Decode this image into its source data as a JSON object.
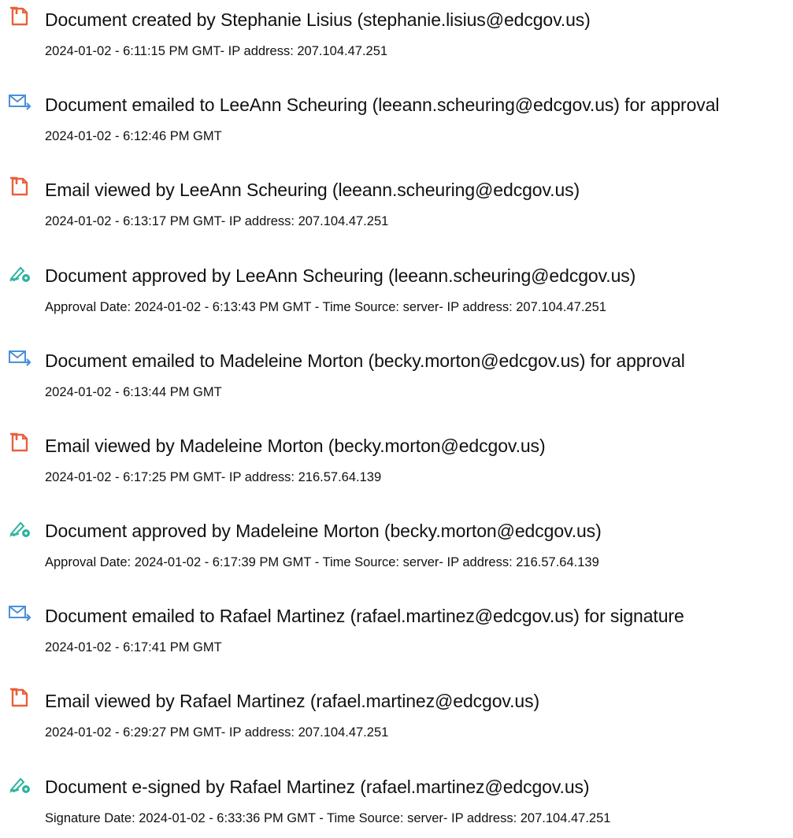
{
  "audit_events": [
    {
      "icon": "document-created-icon",
      "title": "Document created by Stephanie Lisius (stephanie.lisius@edcgov.us)",
      "detail": "2024-01-02 - 6:11:15 PM GMT- IP address: 207.104.47.251"
    },
    {
      "icon": "email-sent-icon",
      "title": "Document emailed to LeeAnn Scheuring (leeann.scheuring@edcgov.us) for approval",
      "detail": "2024-01-02 - 6:12:46 PM GMT"
    },
    {
      "icon": "document-created-icon",
      "title": "Email viewed by LeeAnn Scheuring (leeann.scheuring@edcgov.us)",
      "detail": "2024-01-02 - 6:13:17 PM GMT- IP address: 207.104.47.251"
    },
    {
      "icon": "signature-pen-icon",
      "title": "Document approved by LeeAnn Scheuring (leeann.scheuring@edcgov.us)",
      "detail": "Approval Date: 2024-01-02 - 6:13:43 PM GMT - Time Source: server- IP address: 207.104.47.251"
    },
    {
      "icon": "email-sent-icon",
      "title": "Document emailed to Madeleine Morton (becky.morton@edcgov.us) for approval",
      "detail": "2024-01-02 - 6:13:44 PM GMT"
    },
    {
      "icon": "document-created-icon",
      "title": "Email viewed by Madeleine Morton (becky.morton@edcgov.us)",
      "detail": "2024-01-02 - 6:17:25 PM GMT- IP address: 216.57.64.139"
    },
    {
      "icon": "signature-pen-icon",
      "title": "Document approved by Madeleine Morton (becky.morton@edcgov.us)",
      "detail": "Approval Date: 2024-01-02 - 6:17:39 PM GMT - Time Source: server- IP address: 216.57.64.139"
    },
    {
      "icon": "email-sent-icon",
      "title": "Document emailed to Rafael Martinez (rafael.martinez@edcgov.us) for signature",
      "detail": "2024-01-02 - 6:17:41 PM GMT"
    },
    {
      "icon": "document-created-icon",
      "title": "Email viewed by Rafael Martinez (rafael.martinez@edcgov.us)",
      "detail": "2024-01-02 - 6:29:27 PM GMT- IP address: 207.104.47.251"
    },
    {
      "icon": "signature-pen-icon",
      "title": "Document e-signed by Rafael Martinez (rafael.martinez@edcgov.us)",
      "detail": "Signature Date: 2024-01-02 - 6:33:36 PM GMT - Time Source: server- IP address: 207.104.47.251"
    }
  ],
  "colors": {
    "document_icon": "#e8603c",
    "email_icon": "#4a90d9",
    "signature_icon": "#2bb3a0",
    "text": "#111111"
  }
}
